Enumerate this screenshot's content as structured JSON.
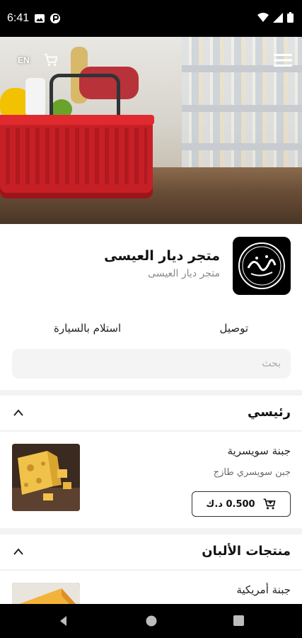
{
  "status": {
    "time": "6:41"
  },
  "hero": {
    "language_toggle": "EN",
    "cart_icon": "cart-icon",
    "menu_icon": "hamburger-menu-icon"
  },
  "store": {
    "name": "متجر ديار العيسى",
    "subtitle": "متجر ديار العيسى",
    "logo_text": "العيسى"
  },
  "tabs": {
    "delivery": "توصيل",
    "pickup": "استلام بالسيارة"
  },
  "search": {
    "placeholder": "بحث"
  },
  "sections": [
    {
      "title": "رئيسي",
      "products": [
        {
          "name": "جبنة سويسرية",
          "description": "جبن سويسري طازج",
          "price": "0.500 د.ك"
        }
      ]
    },
    {
      "title": "منتجات الألبان",
      "products": [
        {
          "name": "جبنة أمريكية"
        }
      ]
    }
  ],
  "colors": {
    "accent": "#c62026",
    "text": "#111111",
    "muted": "#8a8a8a"
  }
}
